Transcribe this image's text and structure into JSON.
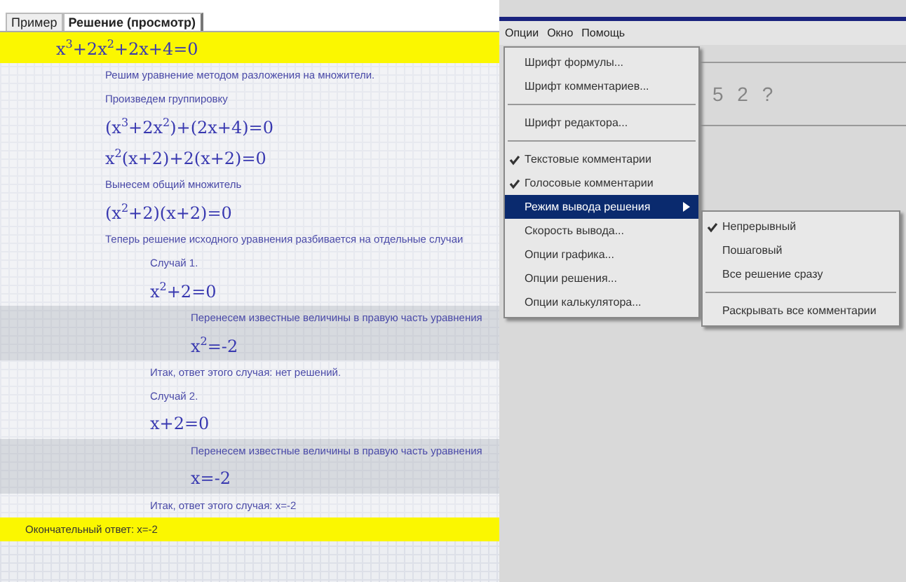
{
  "tabs": [
    {
      "label": "Пример",
      "selected": false
    },
    {
      "label": "Решение (просмотр)",
      "selected": true
    }
  ],
  "solution": [
    {
      "kind": "formula",
      "text": "x$^{3}$+2x$^{2}$+2x+4=0",
      "highlighted": true,
      "children": [
        {
          "kind": "comment",
          "text": "Решим уравнение методом разложения на множители.",
          "highlighted": false
        },
        {
          "kind": "comment",
          "text": "Произведем группировку",
          "highlighted": false
        },
        {
          "kind": "formula",
          "text": "(x$^{3}$+2x$^{2}$)+(2x+4)=0",
          "highlighted": false
        },
        {
          "kind": "formula",
          "text": "x$^{2}$(x+2)+2(x+2)=0",
          "highlighted": false
        },
        {
          "kind": "comment",
          "text": "Вынесем общий множитель",
          "highlighted": false
        },
        {
          "kind": "formula",
          "text": "(x$^{2}$+2)(x+2)=0",
          "highlighted": false
        },
        {
          "kind": "comment",
          "text": "Теперь решение исходного уравнения разбивается на отдельные случаи",
          "highlighted": false,
          "children": [
            {
              "kind": "comment",
              "text": "Случай 1.",
              "highlighted": false
            },
            {
              "kind": "formula",
              "text": "x$^{2}$+2=0",
              "highlighted": false,
              "children": [
                {
                  "kind": "comment",
                  "text": "Перенесем известные величины в правую часть уравнения",
                  "highlighted": false
                },
                {
                  "kind": "formula",
                  "text": "x$^{2}$=-2",
                  "highlighted": false
                }
              ]
            },
            {
              "kind": "comment",
              "text": "Итак, ответ этого случая: нет решений.",
              "highlighted": false
            },
            {
              "kind": "comment",
              "text": "Случай 2.",
              "highlighted": false
            },
            {
              "kind": "formula",
              "text": "x+2=0",
              "highlighted": false,
              "children": [
                {
                  "kind": "comment",
                  "text": "Перенесем известные величины в правую часть уравнения",
                  "highlighted": false
                },
                {
                  "kind": "formula",
                  "text": "x=-2",
                  "highlighted": false
                }
              ]
            },
            {
              "kind": "comment",
              "text": "Итак, ответ этого случая: x=-2",
              "highlighted": false
            }
          ]
        }
      ]
    },
    {
      "kind": "comment",
      "text": "Окончательный ответ: x=-2",
      "highlighted": true
    }
  ],
  "menubar": [
    "Опции",
    "Окно",
    "Помощь"
  ],
  "background_text": "5 2 ?",
  "menu": [
    {
      "kind": "item",
      "label": "Шрифт формулы...",
      "checked": false,
      "selected": false
    },
    {
      "kind": "item",
      "label": "Шрифт комментариев...",
      "checked": false,
      "selected": false
    },
    {
      "kind": "separator"
    },
    {
      "kind": "item",
      "label": "Шрифт редактора...",
      "checked": false,
      "selected": false
    },
    {
      "kind": "separator"
    },
    {
      "kind": "item",
      "label": "Текстовые комментарии",
      "checked": true,
      "selected": false
    },
    {
      "kind": "item",
      "label": "Голосовые комментарии",
      "checked": true,
      "selected": false
    },
    {
      "kind": "submenu",
      "label": "Режим вывода решения",
      "checked": false,
      "selected": true
    },
    {
      "kind": "item",
      "label": "Скорость вывода...",
      "checked": false,
      "selected": false
    },
    {
      "kind": "item",
      "label": "Опции графика...",
      "checked": false,
      "selected": false
    },
    {
      "kind": "item",
      "label": "Опции решения...",
      "checked": false,
      "selected": false
    },
    {
      "kind": "item",
      "label": "Опции калькулятора...",
      "checked": false,
      "selected": false
    }
  ],
  "submenu": [
    {
      "kind": "item",
      "label": "Непрерывный",
      "checked": true,
      "selected": false
    },
    {
      "kind": "item",
      "label": "Пошаговый",
      "checked": false,
      "selected": false
    },
    {
      "kind": "item",
      "label": "Все решение сразу",
      "checked": false,
      "selected": false
    },
    {
      "kind": "separator"
    },
    {
      "kind": "item",
      "label": "Раскрывать все комментарии",
      "checked": false,
      "selected": false
    }
  ]
}
